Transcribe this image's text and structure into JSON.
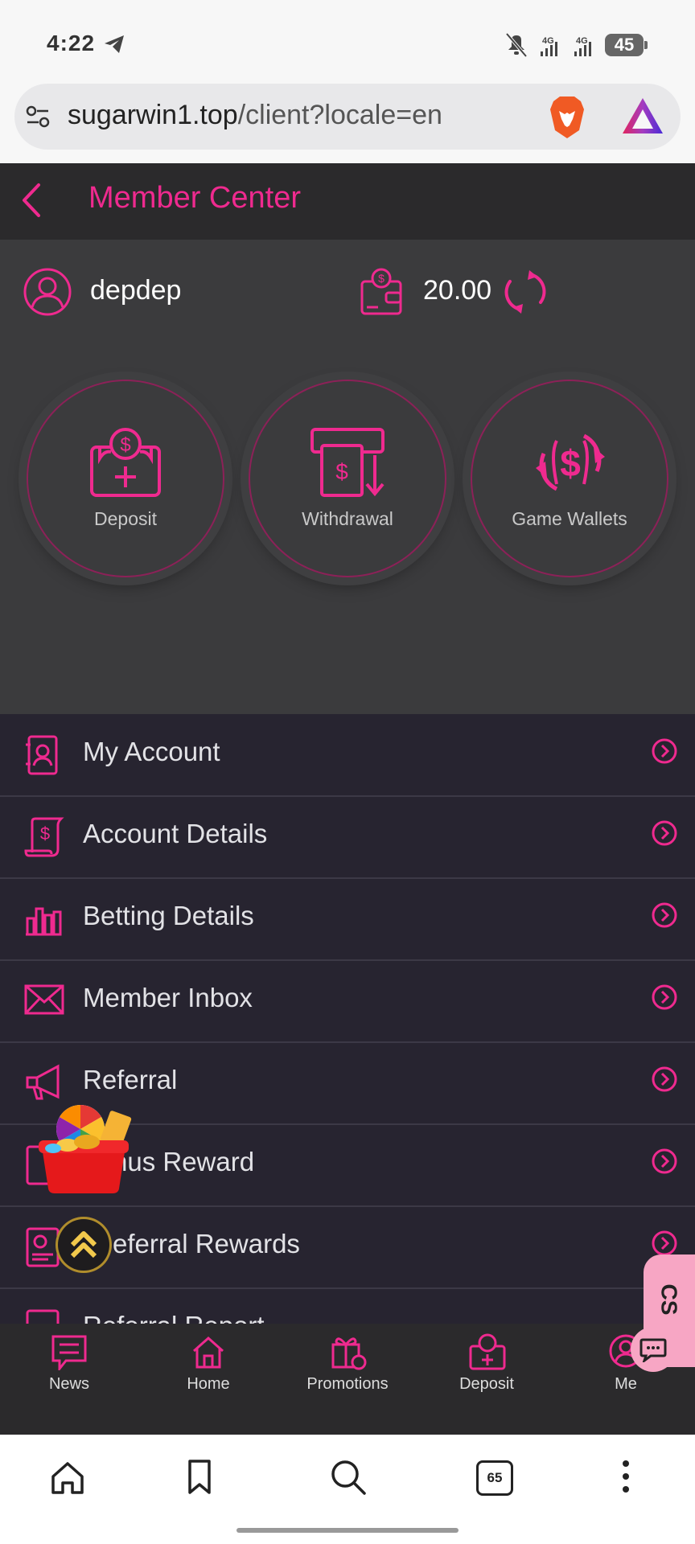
{
  "status_bar": {
    "time": "4:22",
    "battery": "45",
    "network_left": "4G",
    "network_right": "4G"
  },
  "browser": {
    "url_main": "sugarwin1.top",
    "url_path": "/client?locale=en",
    "tab_count": "65"
  },
  "header": {
    "title": "Member Center"
  },
  "profile": {
    "username": "depdep",
    "balance": "20.00"
  },
  "actions": [
    {
      "label": "Deposit"
    },
    {
      "label": "Withdrawal"
    },
    {
      "label": "Game Wallets"
    }
  ],
  "menu": [
    {
      "label": "My Account"
    },
    {
      "label": "Account Details"
    },
    {
      "label": "Betting Details"
    },
    {
      "label": "Member Inbox"
    },
    {
      "label": "Referral"
    },
    {
      "label": "nus Reward"
    },
    {
      "label": "eferral Rewards"
    },
    {
      "label": "Referral Report"
    }
  ],
  "bottom_nav": [
    {
      "label": "News"
    },
    {
      "label": "Home"
    },
    {
      "label": "Promotions"
    },
    {
      "label": "Deposit"
    },
    {
      "label": "Me"
    }
  ],
  "floating": {
    "cs_label": "CS"
  },
  "colors": {
    "accent": "#ef2a8f",
    "header_bg": "#2b2a2c",
    "profile_bg": "#3b3b3d",
    "menu_bg": "#272430"
  }
}
